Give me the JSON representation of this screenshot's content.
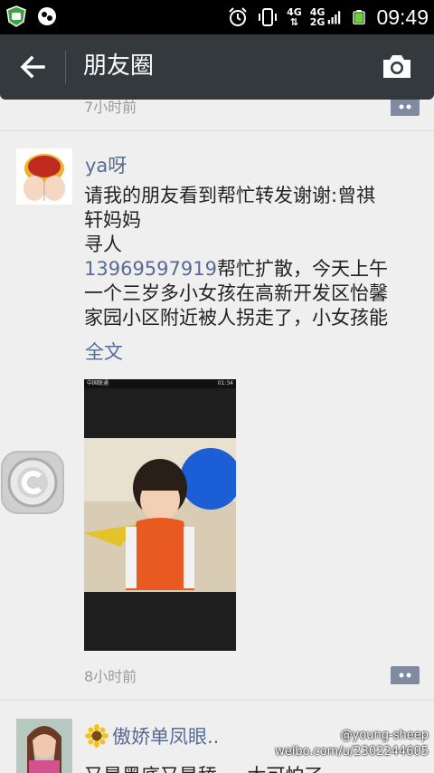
{
  "status_bar": {
    "network_top": "4G",
    "network_bottom_a": "4G",
    "network_bottom_b": "2G",
    "time": "09:49"
  },
  "header": {
    "title": "朋友圈",
    "back_icon": "back-arrow-icon",
    "camera_icon": "camera-icon"
  },
  "feed": {
    "previous_post": {
      "time": "7小时前"
    },
    "post": {
      "name": "ya呀",
      "lines": [
        "请我的朋友看到帮忙转发谢谢:曾祺",
        "轩妈妈",
        "寻人"
      ],
      "phone": "13969597919",
      "after_phone": "帮忙扩散，今天上午",
      "more_lines": [
        "一个三岁多小女孩在高新开发区怡馨",
        "家园小区附近被人拐走了，小女孩能"
      ],
      "full_text_link": "全文",
      "photo_status_carrier": "中国联通",
      "photo_status_time": "01:34",
      "time": "8小时前"
    },
    "next_post": {
      "name": "傲娇单凤眼..",
      "preview": "又是黑底又是舔 ... 太可怕了"
    }
  },
  "watermark": {
    "handle": "@young-sheep",
    "url": "weibo.com/u/2302244605"
  }
}
